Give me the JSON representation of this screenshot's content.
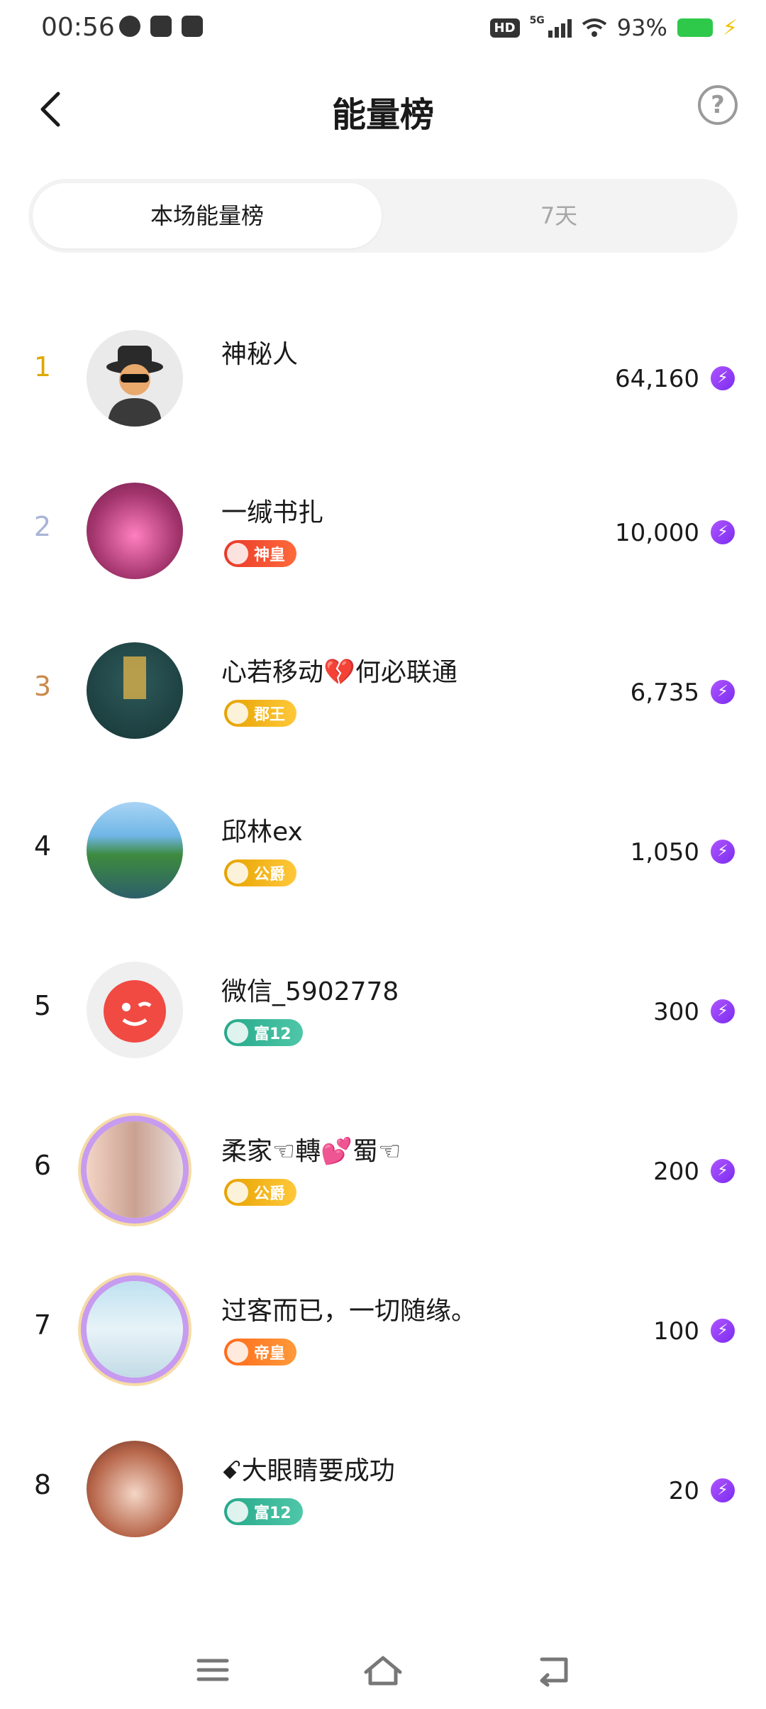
{
  "status_bar": {
    "time": "00:56",
    "network": "5G",
    "hd": "HD",
    "battery": "93%"
  },
  "header": {
    "title": "能量榜",
    "help": "?"
  },
  "tabs": [
    {
      "label": "本场能量榜",
      "active": true
    },
    {
      "label": "7天",
      "active": false
    }
  ],
  "leaderboard": [
    {
      "rank": "1",
      "name": "神秘人",
      "badge": "",
      "score": "64,160"
    },
    {
      "rank": "2",
      "name": "一缄书扎",
      "badge": "神皇",
      "score": "10,000"
    },
    {
      "rank": "3",
      "name": "心若移动💔何必联通",
      "badge": "郡王",
      "score": "6,735"
    },
    {
      "rank": "4",
      "name": "邱林ex",
      "badge": "公爵",
      "score": "1,050"
    },
    {
      "rank": "5",
      "name": "微信_5902778",
      "badge": "富12",
      "score": "300"
    },
    {
      "rank": "6",
      "name": "柔家☜轉💕蜀☜",
      "badge": "公爵",
      "score": "200"
    },
    {
      "rank": "7",
      "name": "过客而已，一切随缘。",
      "badge": "帝皇",
      "score": "100"
    },
    {
      "rank": "8",
      "name": "ꗃ大眼睛要成功",
      "badge": "富12",
      "score": "20"
    }
  ],
  "colors": {
    "rank1": "#e0a800",
    "rank2": "#a9b3d6",
    "rank3": "#c98a4e",
    "energy": "#8a3cf5"
  },
  "icons": {
    "energy": "lightning-bolt-icon",
    "back": "chevron-left-icon",
    "help": "question-circle-icon"
  }
}
